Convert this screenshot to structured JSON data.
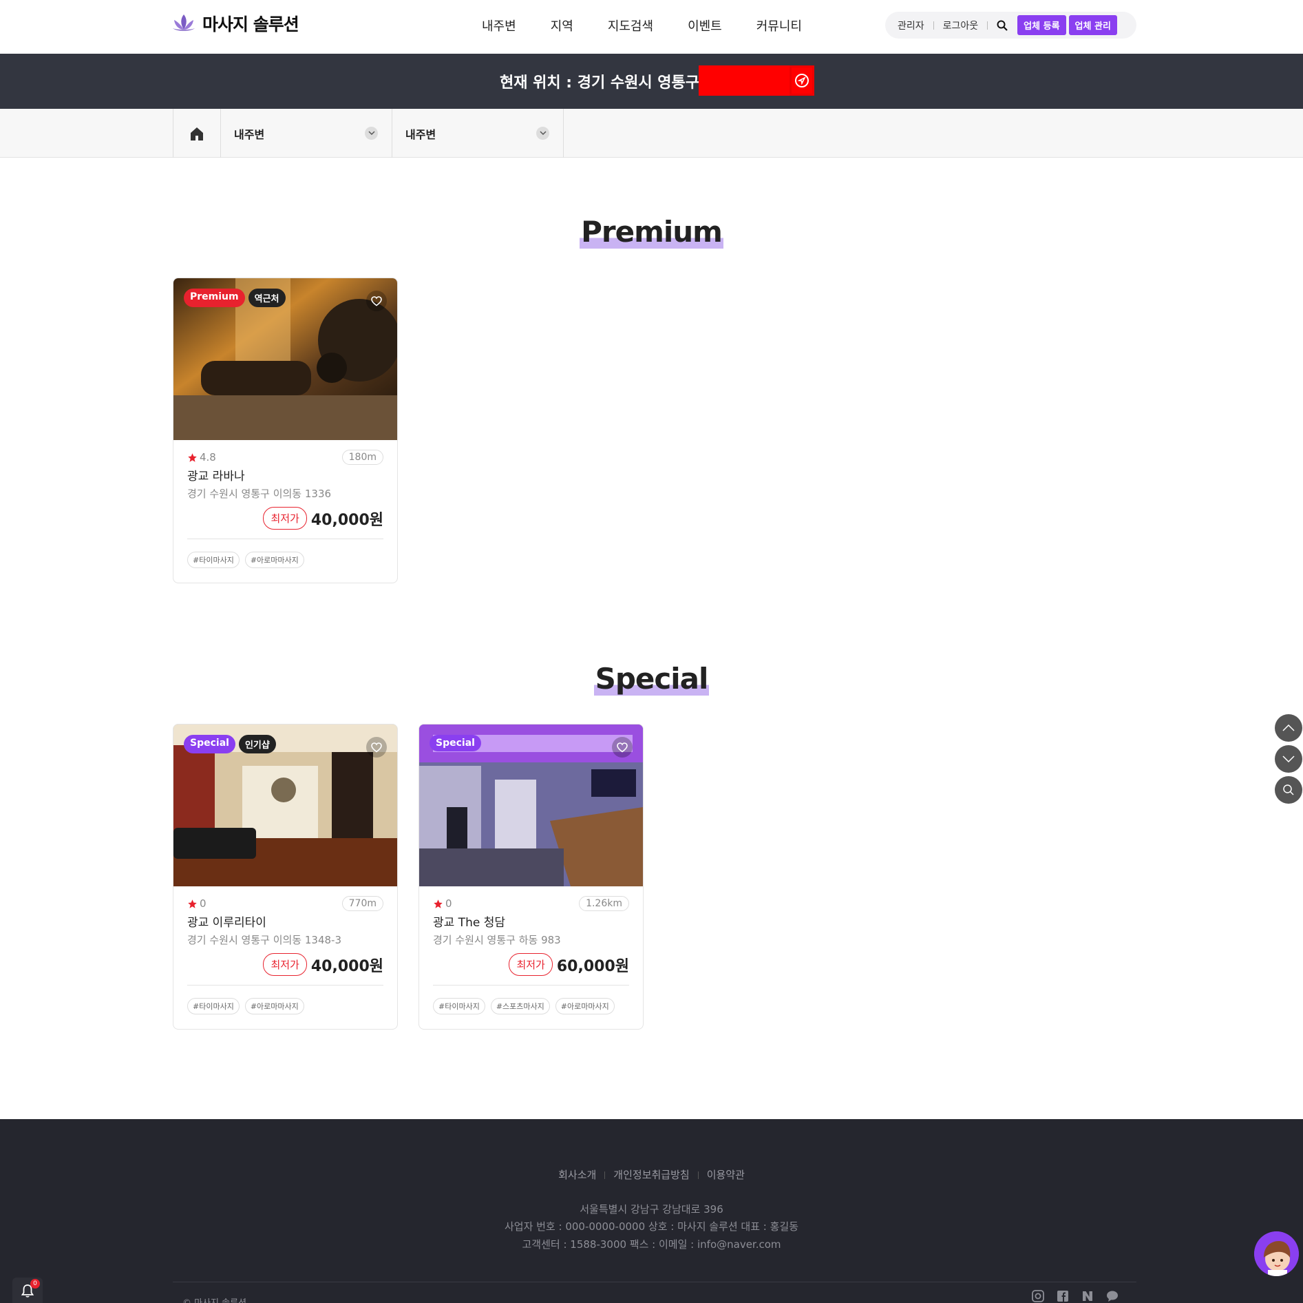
{
  "header": {
    "logo_text": "마사지 솔루션",
    "nav": [
      "내주변",
      "지역",
      "지도검색",
      "이벤트",
      "커뮤니티"
    ],
    "util": {
      "admin": "관리자",
      "logout": "로그아웃",
      "register": "업체 등록",
      "manage": "업체 관리"
    }
  },
  "location": {
    "text": "현재 위치 : 경기 수원시 영통구"
  },
  "filter": {
    "select1": "내주변",
    "select2": "내주변"
  },
  "sections": {
    "premium_title": "Premium",
    "special_title": "Special"
  },
  "cards": [
    {
      "badge": "Premium",
      "badge2": "역근처",
      "rating": "4.8",
      "distance": "180m",
      "name": "광교 라바나",
      "address": "경기 수원시 영통구 이의동 1336",
      "price_label": "최저가",
      "price": "40,000원",
      "tags": [
        "#타이마사지",
        "#아로마마사지"
      ]
    },
    {
      "badge": "Special",
      "badge2": "인기샵",
      "rating": "0",
      "distance": "770m",
      "name": "광교 이루리타이",
      "address": "경기 수원시 영통구 이의동 1348-3",
      "price_label": "최저가",
      "price": "40,000원",
      "tags": [
        "#타이마사지",
        "#아로마마사지"
      ]
    },
    {
      "badge": "Special",
      "rating": "0",
      "distance": "1.26km",
      "name": "광교 The 청담",
      "address": "경기 수원시 영통구 하동 983",
      "price_label": "최저가",
      "price": "60,000원",
      "tags": [
        "#타이마사지",
        "#스포츠마사지",
        "#아로마마사지"
      ]
    }
  ],
  "footer": {
    "links": [
      "회사소개",
      "개인정보취급방침",
      "이용약관"
    ],
    "address": "서울특별시 강남구 강남대로 396",
    "business": "사업자 번호 : 000-0000-0000 상호 : 마사지 솔루션 대표 : 홍길동",
    "contact": "고객센터 : 1588-3000 팩스 : 이메일 : info@naver.com",
    "copyright": "© 마사지 솔루션"
  },
  "notifications": {
    "count": "0"
  },
  "colors": {
    "accent": "#8a3ff0",
    "red": "#e8222e",
    "dark_bar": "#333640",
    "footer": "#25262e"
  }
}
